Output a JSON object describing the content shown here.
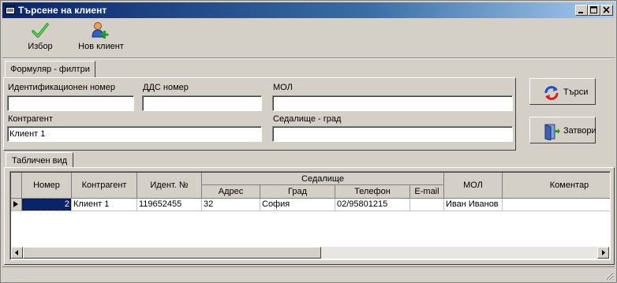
{
  "window": {
    "title": "Търсене на клиент"
  },
  "toolbar": {
    "select_label": "Избор",
    "new_client_label": "Нов клиент"
  },
  "filter_tab": {
    "label": "Формуляр - филтри"
  },
  "filters": {
    "id_number": {
      "label": "Идентификационен номер",
      "value": ""
    },
    "vat_number": {
      "label": "ДДС номер",
      "value": ""
    },
    "mol": {
      "label": "МОЛ",
      "value": ""
    },
    "contractor": {
      "label": "Контрагент",
      "value": "Клиент 1"
    },
    "seat_city": {
      "label": "Седалище - град",
      "value": ""
    }
  },
  "actions": {
    "search_label": "Търси",
    "close_label": "Затвори"
  },
  "table_tab": {
    "label": "Табличен вид"
  },
  "table": {
    "headers": {
      "number": "Номер",
      "contractor": "Контрагент",
      "ident": "Идент. №",
      "seat_group": "Седалище",
      "address": "Адрес",
      "city": "Град",
      "phone": "Телефон",
      "email": "E-mail",
      "mol": "МОЛ",
      "comment": "Коментар"
    },
    "rows": [
      {
        "number": "2",
        "contractor": "Клиент 1",
        "ident": "119652455",
        "address": "32",
        "city": "София",
        "phone": "02/95801215",
        "email": "",
        "mol": "Иван Иванов",
        "comment": ""
      }
    ]
  }
}
